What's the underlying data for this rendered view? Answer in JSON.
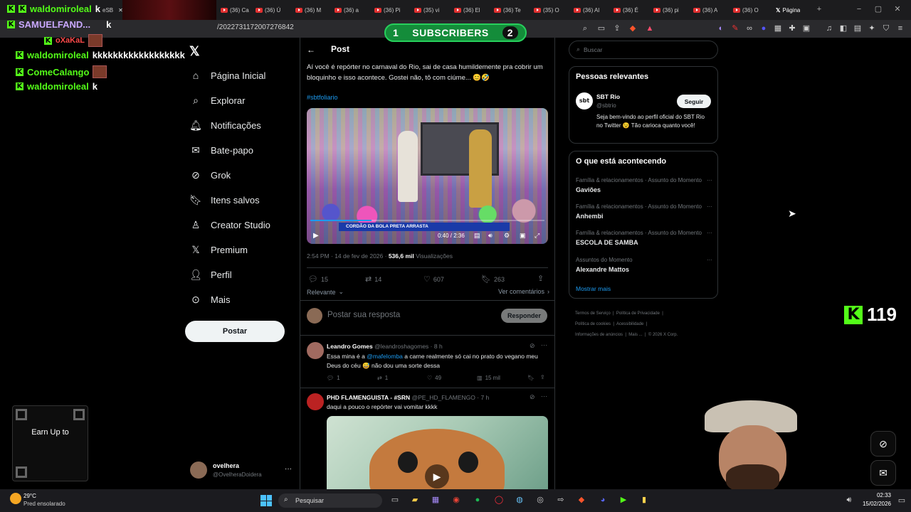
{
  "browser": {
    "tabs": [
      {
        "label": "eSB"
      },
      {
        "label": "(36) Ca"
      },
      {
        "label": "(36) Ú"
      },
      {
        "label": "(36) M"
      },
      {
        "label": "(36) a"
      },
      {
        "label": "(36) Pi"
      },
      {
        "label": "(35) vi"
      },
      {
        "label": "(36) El"
      },
      {
        "label": "(36) Te"
      },
      {
        "label": "(35) O"
      },
      {
        "label": "(36) Al"
      },
      {
        "label": "(36) É"
      },
      {
        "label": "(36) pi"
      },
      {
        "label": "(36) A"
      },
      {
        "label": "(36) O"
      },
      {
        "label": "Página"
      }
    ],
    "url": "/2022731172007276842"
  },
  "stream": {
    "chat": [
      {
        "user": "waldomiroleal",
        "msg": "k",
        "color": "#53fc18"
      },
      {
        "user": "SAMUELFAND...",
        "msg": "k",
        "color": "#c9a8ff"
      },
      {
        "user": "oXaKaL",
        "msg": "",
        "color": "#ff4a4a"
      },
      {
        "user": "waldomiroleal",
        "msg": "kkkkkkkkkkkkkkkkkk",
        "color": "#53fc18"
      },
      {
        "user": "ComeCalango",
        "msg": "",
        "color": "#53fc18"
      },
      {
        "user": "waldomiroleal",
        "msg": "k",
        "color": "#53fc18"
      }
    ],
    "subs_label": "SUBSCRIBERS",
    "subs_left": "1",
    "subs_right": "2",
    "viewer_count": "119",
    "qr_label": "Earn Up to"
  },
  "nav": {
    "items": [
      {
        "label": "Página Inicial",
        "icon": "home-icon"
      },
      {
        "label": "Explorar",
        "icon": "search-icon"
      },
      {
        "label": "Notificações",
        "icon": "bell-icon"
      },
      {
        "label": "Bate-papo",
        "icon": "mail-icon"
      },
      {
        "label": "Grok",
        "icon": "grok-icon"
      },
      {
        "label": "Itens salvos",
        "icon": "bookmark-icon"
      },
      {
        "label": "Creator Studio",
        "icon": "creator-icon"
      },
      {
        "label": "Premium",
        "icon": "x-icon"
      },
      {
        "label": "Perfil",
        "icon": "person-icon"
      },
      {
        "label": "Mais",
        "icon": "more-icon"
      }
    ],
    "post_button": "Postar",
    "account_name": "ovelhera",
    "account_handle": "@OvelheraDoidera"
  },
  "post": {
    "header": "Post",
    "text": "Aí você é repórter no carnaval do Rio, sai de casa humildemente pra cobrir um bloquinho e isso acontece. Gostei não, tô com ciúme... 😊🤣",
    "hashtag": "#sbtfoliario",
    "video_time": "0:40 / 2:36",
    "video_caption": "CORDÃO DA BOLA PRETA ARRASTA",
    "timestamp": "2:54 PM · 14 de fev de 2026 · ",
    "views": "536,6 mil",
    "views_label": "Visualizações",
    "replies": "15",
    "reposts": "14",
    "likes": "607",
    "bookmarks": "263",
    "sort_label": "Relevante",
    "comments_link": "Ver comentários",
    "reply_placeholder": "Postar sua resposta",
    "reply_button": "Responder"
  },
  "replies": [
    {
      "name": "Leandro Gomes",
      "handle": "@leandroshagomes · 8 h",
      "text_pre": "Essa mina é a ",
      "mention": "@mafelomba",
      "text_post": " a carne realmente só cai no prato do vegano meu Deus do céu 😅 não dou uma sorte dessa",
      "replies": "1",
      "reposts": "1",
      "likes": "49",
      "views": "15 mil"
    },
    {
      "name": "PHD FLAMENGUISTA - #SRN",
      "handle": "@PE_HD_FLAMENGO · 7 h",
      "text": "daqui a pouco o repórter vai vomitar kkkk"
    }
  ],
  "right": {
    "search_placeholder": "Buscar",
    "relevant_title": "Pessoas relevantes",
    "person_name": "SBT Rio",
    "person_handle": "@sbtrio",
    "person_bio": "Seja bem-vindo ao perfil oficial do SBT Rio no Twitter 😉 Tão carioca quanto você!",
    "follow_button": "Seguir",
    "trends_title": "O que está acontecendo",
    "trends": [
      {
        "category": "Família & relacionamentos · Assunto do Momento",
        "name": "Gaviões"
      },
      {
        "category": "Família & relacionamentos · Assunto do Momento",
        "name": "Anhembi"
      },
      {
        "category": "Família & relacionamentos · Assunto do Momento",
        "name": "ESCOLA DE SAMBA"
      },
      {
        "category": "Assuntos do Momento",
        "name": "Alexandre Mattos"
      }
    ],
    "show_more": "Mostrar mais",
    "footer": [
      "Termos de Serviço",
      "Política de Privacidade",
      "Política de cookies",
      "Acessibilidade",
      "Informações de anúncios",
      "Mais ...",
      "© 2026 X Corp."
    ]
  },
  "taskbar": {
    "weather_temp": "29°C",
    "weather_desc": "Pred ensolarado",
    "search_label": "Pesquisar",
    "time": "02:33",
    "date": "15/02/2026"
  },
  "colors": {
    "accent": "#1d9bf0",
    "kick_green": "#53fc18",
    "subs_green": "#148c3a"
  }
}
